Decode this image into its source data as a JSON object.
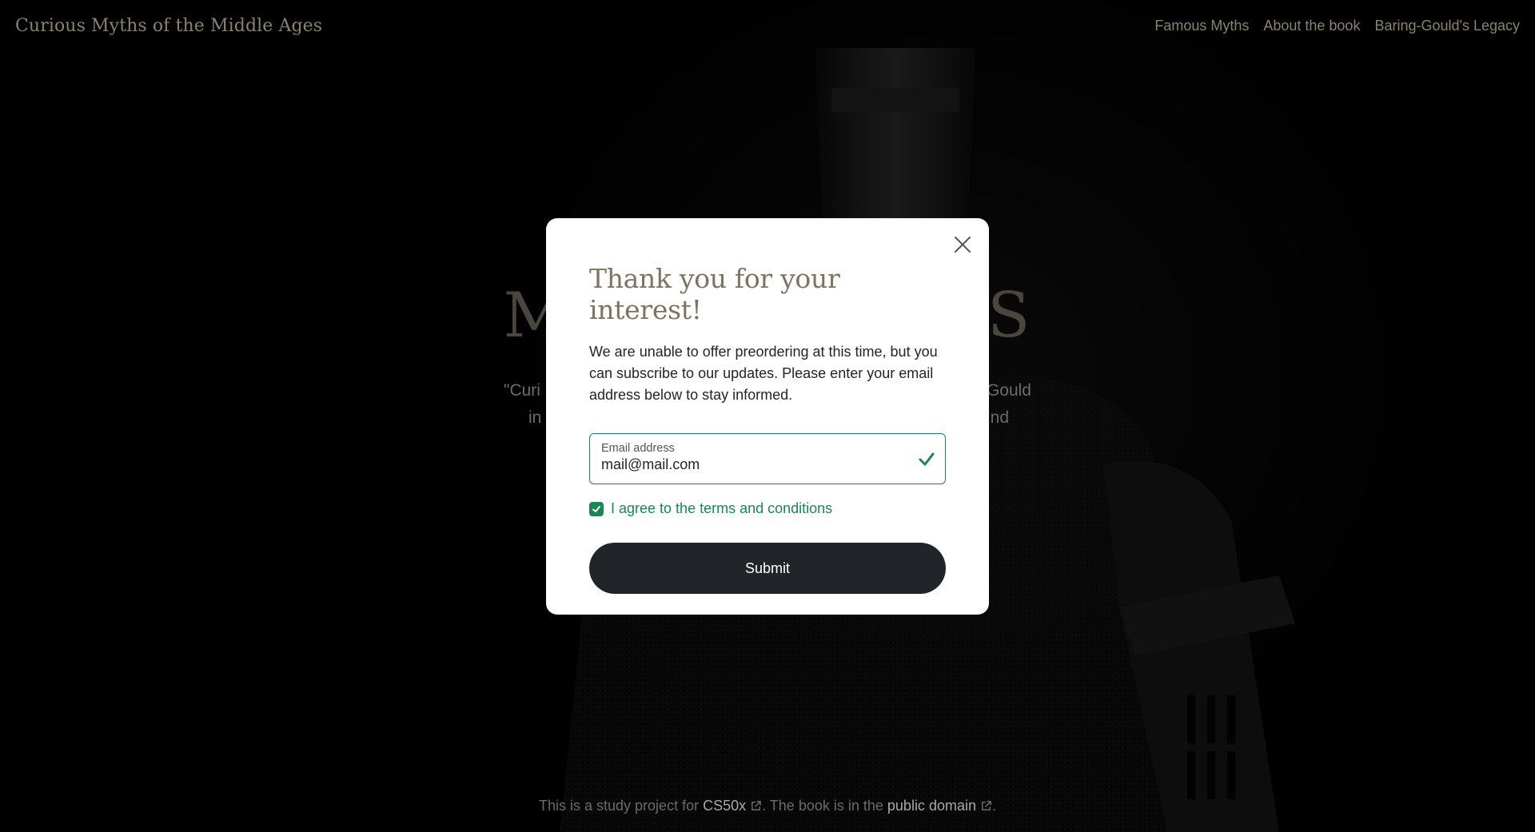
{
  "brand": "Curious Myths of the Middle Ages",
  "nav": {
    "links": [
      "Famous Myths",
      "About the book",
      "Baring-Gould's Legacy"
    ]
  },
  "hero": {
    "title_left": "M",
    "title_right": "S",
    "desc_line1_left": "\"Curi",
    "desc_line1_right": "Gould",
    "desc_line2_left": "in",
    "desc_line2_right": "nd"
  },
  "modal": {
    "title": "Thank you for your interest!",
    "text": "We are unable to offer preordering at this time, but you can subscribe to our updates. Please enter your email address below to stay informed.",
    "email_label": "Email address",
    "email_value": "mail@mail.com",
    "agree_label": "I agree to the terms and conditions",
    "agree_checked": true,
    "submit_label": "Submit"
  },
  "footer": {
    "prefix": "This is a study project for",
    "link1": "CS50x",
    "middle": ". The book is in the",
    "link2": "public domain",
    "suffix": "."
  },
  "colors": {
    "accent": "#198754",
    "button": "#212529",
    "title": "#7e7261",
    "brand": "#8a826f"
  }
}
